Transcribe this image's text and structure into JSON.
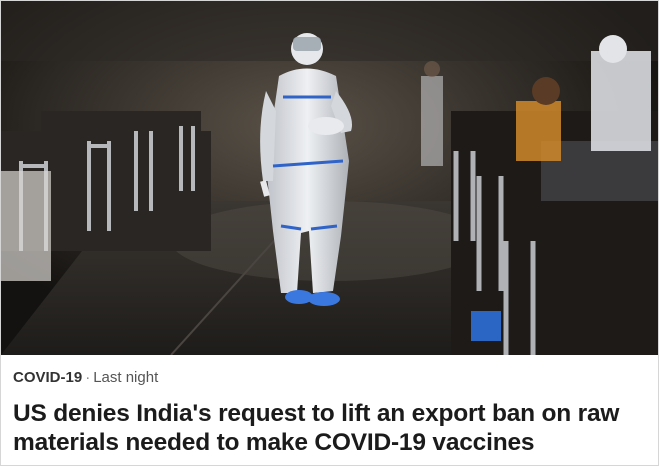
{
  "article": {
    "category": "COVID-19",
    "separator": "·",
    "time": "Last night",
    "headline": "US denies India's request to lift an export ban on raw materials needed to make COVID-19 vaccines"
  },
  "photo": {
    "subject": "health worker in protective suit walking between hospital beds"
  }
}
